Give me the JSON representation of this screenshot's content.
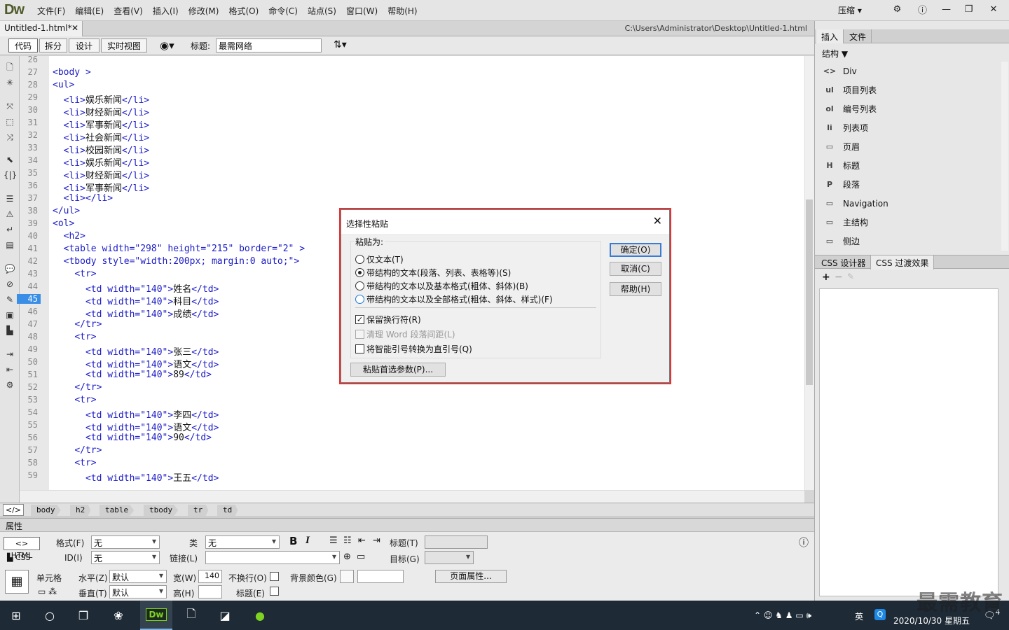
{
  "app": {
    "logo": "Dw",
    "menus": [
      "文件(F)",
      "编辑(E)",
      "查看(V)",
      "插入(I)",
      "修改(M)",
      "格式(O)",
      "命令(C)",
      "站点(S)",
      "窗口(W)",
      "帮助(H)"
    ],
    "compress": "压缩"
  },
  "document": {
    "tab_label": "Untitled-1.html*",
    "path": "C:\\Users\\Administrator\\Desktop\\Untitled-1.html",
    "views": [
      "代码",
      "拆分",
      "设计",
      "实时视图"
    ],
    "title_label": "标题:",
    "title_value": "最需网络"
  },
  "editor": {
    "active_line": 45,
    "lines": [
      {
        "n": "26",
        "text": ""
      },
      {
        "n": "27",
        "text": "<body >"
      },
      {
        "n": "28",
        "text": "<ul>"
      },
      {
        "n": "29",
        "text": "  <li>娱乐新闻</li>"
      },
      {
        "n": "30",
        "text": "  <li>财经新闻</li>"
      },
      {
        "n": "31",
        "text": "  <li>军事新闻</li>"
      },
      {
        "n": "32",
        "text": "  <li>社会新闻</li>"
      },
      {
        "n": "33",
        "text": "  <li>校园新闻</li>"
      },
      {
        "n": "34",
        "text": "  <li>娱乐新闻</li>"
      },
      {
        "n": "35",
        "text": "  <li>财经新闻</li>"
      },
      {
        "n": "36",
        "text": "  <li>军事新闻</li>"
      },
      {
        "n": "37",
        "text": "  <li></li>"
      },
      {
        "n": "38",
        "text": "</ul>"
      },
      {
        "n": "39",
        "text": "<ol>"
      },
      {
        "n": "40",
        "text": "  <h2>"
      },
      {
        "n": "41",
        "text": "  <table width=\"298\" height=\"215\" border=\"2\" >"
      },
      {
        "n": "42",
        "text": "  <tbody style=\"width:200px; margin:0 auto;\">"
      },
      {
        "n": "43",
        "text": "    <tr>"
      },
      {
        "n": "44",
        "text": "      <td width=\"140\">姓名</td>"
      },
      {
        "n": "45",
        "text": "      <td width=\"140\">科目</td>"
      },
      {
        "n": "46",
        "text": "      <td width=\"140\">成绩</td>"
      },
      {
        "n": "47",
        "text": "    </tr>"
      },
      {
        "n": "48",
        "text": "    <tr>"
      },
      {
        "n": "49",
        "text": "      <td width=\"140\">张三</td>"
      },
      {
        "n": "50",
        "text": "      <td width=\"140\">语文</td>"
      },
      {
        "n": "51",
        "text": "      <td width=\"140\">89</td>"
      },
      {
        "n": "52",
        "text": "    </tr>"
      },
      {
        "n": "53",
        "text": "    <tr>"
      },
      {
        "n": "54",
        "text": "      <td width=\"140\">李四</td>"
      },
      {
        "n": "55",
        "text": "      <td width=\"140\">语文</td>"
      },
      {
        "n": "56",
        "text": "      <td width=\"140\">90</td>"
      },
      {
        "n": "57",
        "text": "    </tr>"
      },
      {
        "n": "58",
        "text": "    <tr>"
      },
      {
        "n": "59",
        "text": "      <td width=\"140\">王五</td>"
      }
    ]
  },
  "tagbar": [
    "body",
    "h2",
    "table",
    "tbody",
    "tr",
    "td"
  ],
  "properties": {
    "header": "属性",
    "html_btn": "HTML",
    "css_btn": "CSS",
    "format_label": "格式(F)",
    "format_value": "无",
    "class_label": "类",
    "class_value": "无",
    "id_label": "ID(I)",
    "id_value": "无",
    "link_label": "链接(L)",
    "title_label": "标题(T)",
    "target_label": "目标(G)",
    "cell_label": "单元格",
    "horz_label": "水平(Z)",
    "horz_value": "默认",
    "vert_label": "垂直(T)",
    "vert_value": "默认",
    "width_label": "宽(W)",
    "width_value": "140",
    "height_label": "高(H)",
    "nowrap_label": "不换行(O)",
    "header_label": "标题(E)",
    "bg_label": "背景颜色(G)",
    "page_props": "页面属性..."
  },
  "right_panel": {
    "tabs": [
      "插入",
      "文件"
    ],
    "category": "结构",
    "items": [
      {
        "icon": "<>",
        "label": "Div"
      },
      {
        "icon": "ul",
        "label": "项目列表"
      },
      {
        "icon": "ol",
        "label": "编号列表"
      },
      {
        "icon": "li",
        "label": "列表项"
      },
      {
        "icon": "▭",
        "label": "页眉"
      },
      {
        "icon": "H",
        "label": "标题"
      },
      {
        "icon": "P",
        "label": "段落"
      },
      {
        "icon": "▭",
        "label": "Navigation"
      },
      {
        "icon": "▭",
        "label": "主结构"
      },
      {
        "icon": "▭",
        "label": "侧边"
      }
    ],
    "css_tabs": [
      "CSS 设计器",
      "CSS 过渡效果"
    ]
  },
  "dialog": {
    "title": "选择性粘贴",
    "group_label": "粘贴为:",
    "options": [
      {
        "label": "仅文本(T)",
        "selected": false
      },
      {
        "label": "带结构的文本(段落、列表、表格等)(S)",
        "selected": true
      },
      {
        "label": "带结构的文本以及基本格式(粗体、斜体)(B)",
        "selected": false
      },
      {
        "label": "带结构的文本以及全部格式(粗体、斜体、样式)(F)",
        "selected": false
      }
    ],
    "checks": [
      {
        "label": "保留换行符(R)",
        "checked": true,
        "disabled": false
      },
      {
        "label": "清理 Word 段落间距(L)",
        "checked": false,
        "disabled": true
      },
      {
        "label": "将智能引号转换为直引号(Q)",
        "checked": false,
        "disabled": false
      }
    ],
    "ok": "确定(O)",
    "cancel": "取消(C)",
    "help": "帮助(H)",
    "prefs": "粘贴首选参数(P)..."
  },
  "taskbar": {
    "lang": "英",
    "date": "2020/10/30 星期五",
    "notif_count": "4"
  },
  "watermark": "最需教育"
}
